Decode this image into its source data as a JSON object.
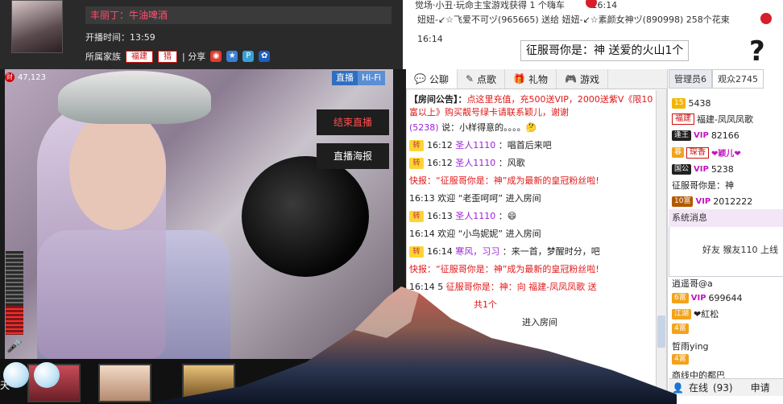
{
  "header": {
    "anchor_name": "丰丽丁：牛油啤酒",
    "start_time": "开播时间：13:59",
    "family_label": "所属家族",
    "family_tags": [
      "福建",
      "猎"
    ],
    "share_label": "| 分享"
  },
  "video": {
    "fortune_count": "47,123",
    "fortune_icon": "财",
    "live_badge": "直播",
    "hifi_badge": "Hi-Fi",
    "end_live_button": "结束直播",
    "poster_button": "直播海报",
    "day_label": "天"
  },
  "banner": {
    "line1": "觉场·小丑·玩命主宝游戏获得 1 个嗨车",
    "line1_time": "16:14",
    "line2": "妞妞-↙☆飞爱不可ヅ(965665) 送给 妞妞-↙☆素颜女神ヅ(890998) 258个花束",
    "time": "16:14",
    "popup": "征服哥你是：神  送爱的火山1个",
    "question_mark": "?"
  },
  "tabs": [
    "公聊",
    "点歌",
    "礼物",
    "游戏"
  ],
  "chat": {
    "notice_label": "【房间公告】：",
    "notice_text": "点这里充值，充500送VIP，2000送紫V《限10富以上》购买靓号绿卡请联系颖儿，谢谢",
    "lines": [
      {
        "prefix": "(5238)",
        "text": " 说：小样得意的。。。。🤔"
      },
      {
        "badge": "转",
        "time": "16:12",
        "user": "圣人1110",
        "text": "：唱首后来吧"
      },
      {
        "badge": "转",
        "time": "16:12",
        "user": "圣人1110",
        "text": "：风歌"
      },
      {
        "flash": "快报：“征服哥你是：神”成为最新的皇冠粉丝啦!"
      },
      {
        "time": "16:13",
        "text": "欢迎 “老歪呵呵” 进入房间"
      },
      {
        "badge": "转",
        "time": "16:13",
        "user": "圣人1110",
        "text": "：😄"
      },
      {
        "time": "16:14",
        "text": "欢迎 “小鸟妮妮” 进入房间"
      },
      {
        "badge": "转",
        "time": "16:14",
        "user": "寒风，习习",
        "text": "：来一首，梦醒时分，吧"
      },
      {
        "flash": "快报：“征服哥你是：神”成为最新的皇冠粉丝啦!"
      },
      {
        "time": "16:14 5",
        "text": "征服哥你是：神：向 福建-凤凤凤歌 送"
      },
      {
        "text": "共1个"
      },
      {
        "text": "进入房间"
      }
    ]
  },
  "right": {
    "tab_admin": "管理员6",
    "tab_viewers": "观众2745",
    "users": [
      {
        "lv": "15",
        "name": "5438"
      },
      {
        "fam": "福建",
        "name": "福建-凤凤凤歌"
      },
      {
        "lv": "逢王",
        "vip": "VIP",
        "name": "82166"
      },
      {
        "lv": "暮",
        "fam": "琛香",
        "name": "❤颖儿❤"
      },
      {
        "lv": "国公",
        "vip": "VIP",
        "name": "5238"
      },
      {
        "name": "征服哥你是：神"
      },
      {
        "lv": "10富",
        "vip": "VIP",
        "name": "2012222"
      }
    ],
    "sys_title": "系统消息",
    "sys_body": "好友 猴友110 上线",
    "users2": [
      {
        "name": "逍遥哥@a"
      },
      {
        "lv": "6富",
        "vip": "VIP",
        "name": "699644"
      },
      {
        "lv": "江湖",
        "name": "❤紅松"
      },
      {
        "lv": "4富",
        "name": ""
      },
      {
        "name": "哲雨ying"
      },
      {
        "lv": "4富",
        "name": ""
      },
      {
        "name": "商线中的都巴"
      }
    ],
    "online_label": "在线",
    "online_count": "(93)",
    "apply_label": "申请"
  },
  "colors": {
    "accent": "#e01818",
    "vip": "#c014c0",
    "live": "#2e6fbf"
  }
}
